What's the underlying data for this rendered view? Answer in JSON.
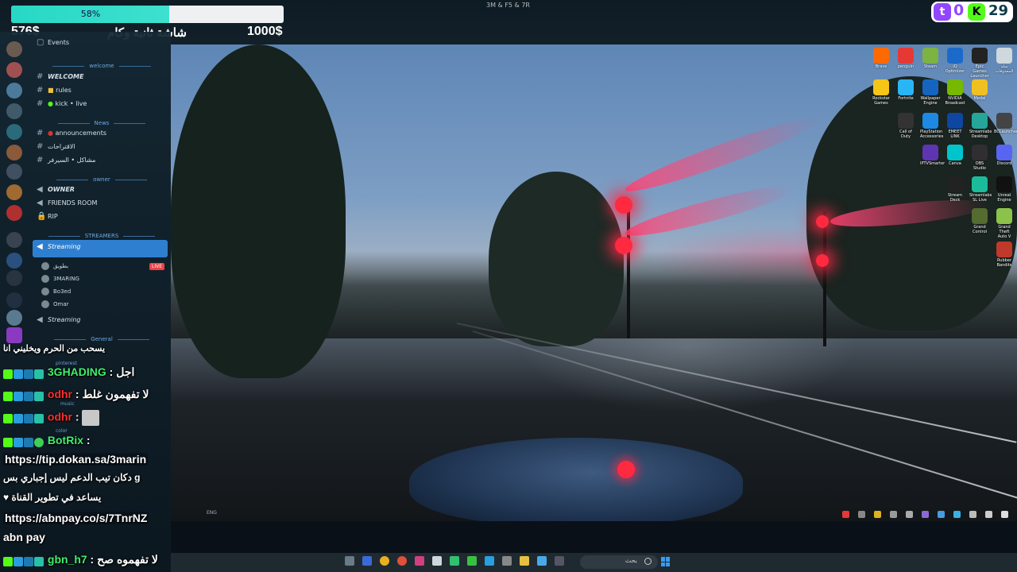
{
  "stream_overlay": {
    "goal_progress_label": "58%",
    "goal_progress_fraction": 0.58,
    "goal_current": "576$",
    "goal_title": "شاشة ثانية وكام",
    "goal_target": "1000$",
    "window_title": "3M & F5 & 7R"
  },
  "viewer_counter": {
    "twitch_count": "0",
    "kick_count": "29"
  },
  "discord": {
    "events_label": "Events",
    "categories": {
      "welcome": "welcome",
      "news": "News",
      "owner": "owner",
      "streamers": "STREAMERS",
      "general": "General"
    },
    "channels": {
      "welcome": "WELCOME",
      "rules": "rules",
      "kick_live": "kick • live",
      "announcements": "announcements",
      "suggestions": "الاقتراحات",
      "problems": "مشاكل • السيرفر",
      "owner": "OWNER",
      "friends_room": "FRIENDS ROOM",
      "rip": "RIP",
      "streaming_1": "Streaming",
      "streaming_2": "Streaming",
      "pinterest": "pinterest",
      "music": "music",
      "color": "color"
    },
    "voice_users": [
      "بطويق",
      "3MARING",
      "Bo3ed",
      "Omar"
    ],
    "live_badge": "LIVE"
  },
  "chat": [
    {
      "text": "يسحب من الحرم ويخليني انا"
    },
    {
      "user": "3GHADING",
      "message": "اجل"
    },
    {
      "user": "odhr",
      "message": "لا تفهمون غلط"
    },
    {
      "user": "odhr",
      "message": ""
    },
    {
      "user": "BotRix",
      "message": ""
    },
    {
      "text": "https://tip.dokan.sa/3marin"
    },
    {
      "text": "دكان تيب الدعم ليس إجباري بس g"
    },
    {
      "text": "يساعد في تطوير القناة"
    },
    {
      "text": "https://abnpay.co/s/7TnrNZ"
    },
    {
      "text": "abn pay"
    },
    {
      "user": "gbn_h7",
      "message": "لا تفهموه صح"
    }
  ],
  "desktop_icons": [
    "Brave",
    "penguin",
    "Steam",
    "IQ Optimizer",
    "Epic Games Launcher",
    "سلة المحذوفات",
    "Rockstar Games",
    "Fortnite",
    "Wallpaper Engine",
    "NVIDIA Broadcast",
    "Medal",
    "Call of Duty",
    "PlayStation Accessories",
    "EMEET LINK",
    "Streamlabs Desktop",
    "BCLauncher",
    "IPTVSmarter",
    "Canva",
    "OBS Studio",
    "Discord",
    "Stream Deck",
    "Streamlabs SL Live",
    "Unreal Engine",
    "Grand Control",
    "Grand Theft Auto V",
    "Rubber Bandits"
  ],
  "taskbar": {
    "search_placeholder": "بحث",
    "tray_language": "ENG"
  },
  "colors": {
    "twitch": "#9146ff",
    "kick": "#53fc18",
    "progress": "#27d8c5",
    "discord_selected": "#2f7fd0",
    "chat_username_green": "#3ff06b",
    "chat_username_red": "#ff2d2d"
  }
}
